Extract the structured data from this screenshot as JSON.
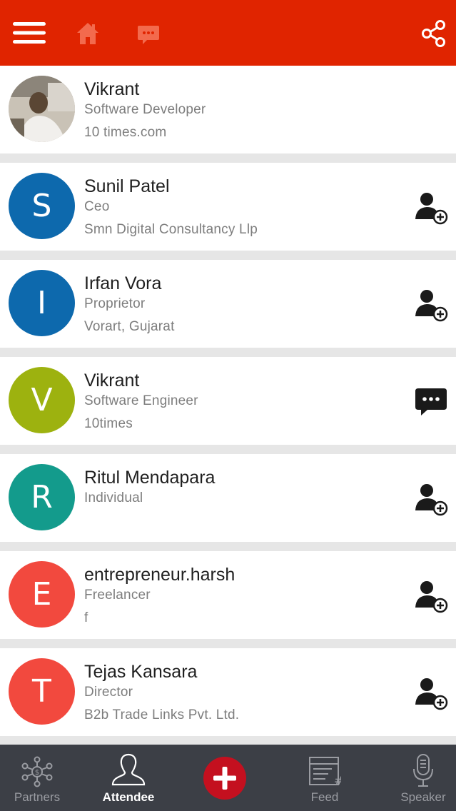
{
  "topbar": {
    "bg": "#e02400",
    "icons": [
      "menu-icon",
      "home-icon",
      "chat-icon",
      "share-icon"
    ]
  },
  "attendees": [
    {
      "name": "Vikrant",
      "title": "Software Developer",
      "company": "10 times.com",
      "initial": "",
      "avatar_type": "photo",
      "color": "#b9b0a2",
      "action": "none"
    },
    {
      "name": "Sunil Patel",
      "title": "Ceo",
      "company": "Smn Digital Consultancy Llp",
      "initial": "S",
      "avatar_type": "letter",
      "color": "#0d69ad",
      "action": "add-connection"
    },
    {
      "name": "Irfan Vora",
      "title": "Proprietor",
      "company": "Vorart, Gujarat",
      "initial": "I",
      "avatar_type": "letter",
      "color": "#0d69ad",
      "action": "add-connection"
    },
    {
      "name": "Vikrant",
      "title": "Software Engineer",
      "company": "10times",
      "initial": "V",
      "avatar_type": "letter",
      "color": "#9db20f",
      "action": "message"
    },
    {
      "name": "Ritul Mendapara",
      "title": "Individual",
      "company": "",
      "initial": "R",
      "avatar_type": "letter",
      "color": "#139b8c",
      "action": "add-connection"
    },
    {
      "name": "entrepreneur.harsh",
      "title": "Freelancer",
      "company": "f",
      "initial": "E",
      "avatar_type": "letter",
      "color": "#f2493e",
      "action": "add-connection"
    },
    {
      "name": "Tejas Kansara",
      "title": "Director",
      "company": "B2b Trade Links Pvt. Ltd.",
      "initial": "T",
      "avatar_type": "letter",
      "color": "#f2493e",
      "action": "add-connection"
    }
  ],
  "tabs": {
    "partners": "Partners",
    "attendee": "Attendee",
    "feed": "Feed",
    "speaker": "Speaker",
    "active": "attendee",
    "fab_color": "#c4101f"
  }
}
